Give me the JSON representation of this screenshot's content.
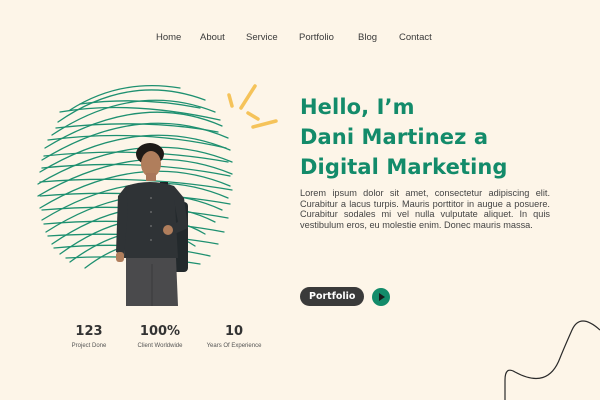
{
  "nav": {
    "items": [
      "Home",
      "About",
      "Service",
      "Portfolio",
      "Blog",
      "Contact"
    ]
  },
  "hero": {
    "heading_lines": [
      "Hello, I’m",
      "Dani Martinez a",
      "Digital Marketing"
    ],
    "body": "Lorem ipsum dolor sit amet, consectetur adipiscing elit. Curabitur a lacus turpis. Mauris porttitor in augue a posuere. Curabitur sodales mi vel nulla vulputate aliquet. In quis vestibulum eros, eu molestie enim. Donec mauris massa.",
    "portfolio_label": "Portfolio",
    "play_icon": "play-icon"
  },
  "stats": [
    {
      "value": "123",
      "label": "Project Done"
    },
    {
      "value": "100%",
      "label": "Client Worldwide"
    },
    {
      "value": "10",
      "label": "Years Of Experience"
    }
  ],
  "colors": {
    "background": "#fdf5e8",
    "accent_green": "#138b6a",
    "accent_yellow": "#f5c35a",
    "dark": "#3a3a3a"
  }
}
